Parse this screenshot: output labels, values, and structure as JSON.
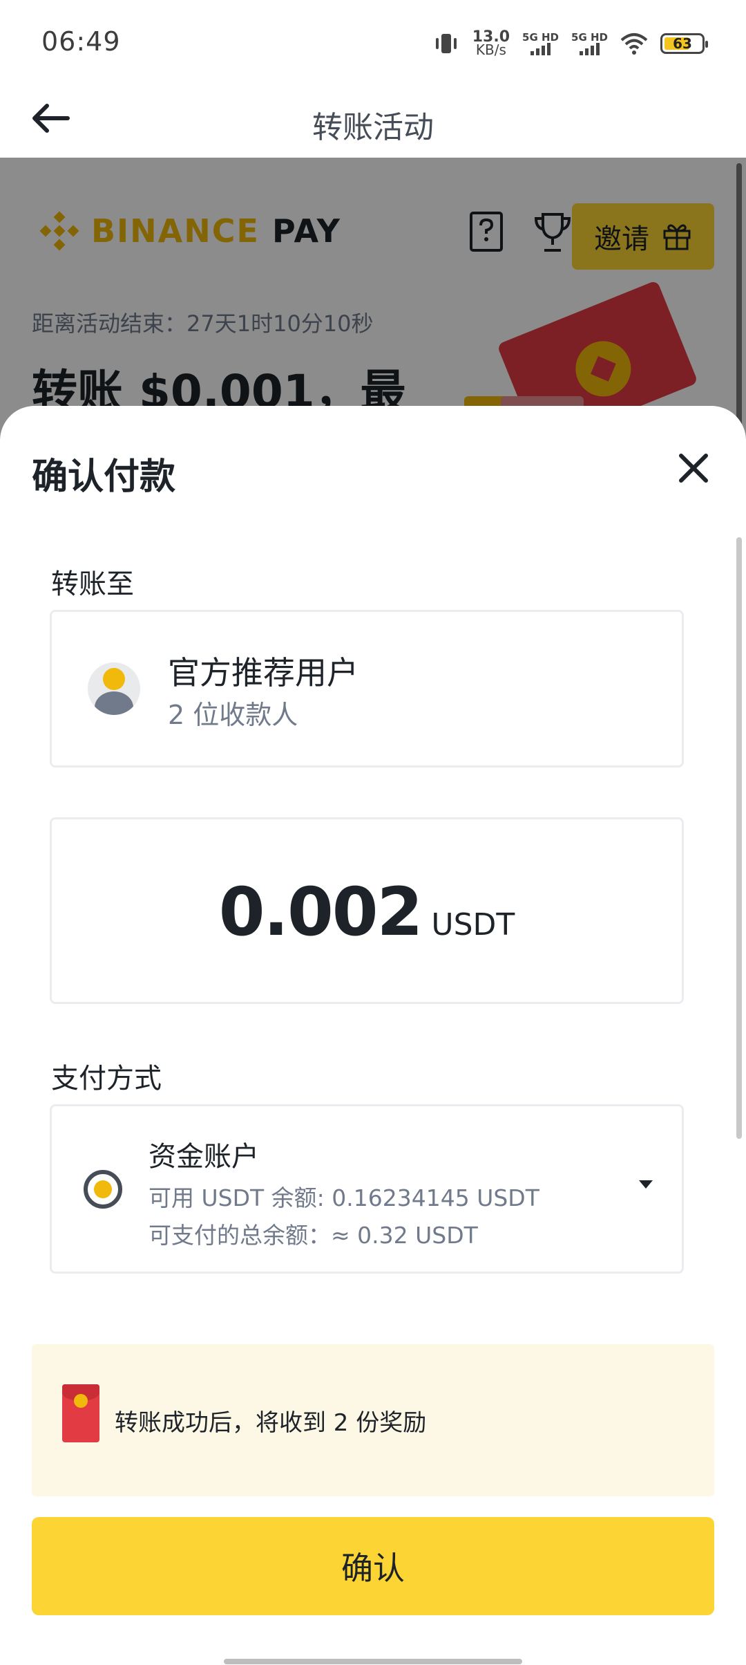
{
  "status_bar": {
    "time": "06:49",
    "net_speed_value": "13.0",
    "net_speed_unit": "KB/s",
    "sim1_label": "5G HD",
    "sim2_label": "5G HD",
    "battery_level": "63"
  },
  "header": {
    "title": "转账活动",
    "back_icon": "arrow-left-icon"
  },
  "background_page": {
    "brand_name": "BINANCE",
    "brand_suffix": "PAY",
    "invite_label": "邀请",
    "countdown": "距离活动结束：27天1时10分10秒",
    "promo_headline": "转账 $0.001，最"
  },
  "sheet": {
    "title": "确认付款",
    "close_icon": "close-icon",
    "transfer_to_label": "转账至",
    "recipient_name": "官方推荐用户",
    "recipient_count": "2 位收款人",
    "amount": "0.002",
    "amount_unit": "USDT",
    "payment_method_label": "支付方式",
    "account_name": "资金账户",
    "available_balance": "可用 USDT 余额: 0.16234145 USDT",
    "total_payable": "可支付的总余额：≈ 0.32 USDT",
    "reward_message": "转账成功后，将收到 2 份奖励",
    "confirm_label": "确认"
  },
  "colors": {
    "accent": "#FCD535",
    "brand": "#F0B90B",
    "text_primary": "#1E2329",
    "text_secondary": "#707A8A",
    "banner_bg": "#FDF8E6"
  }
}
